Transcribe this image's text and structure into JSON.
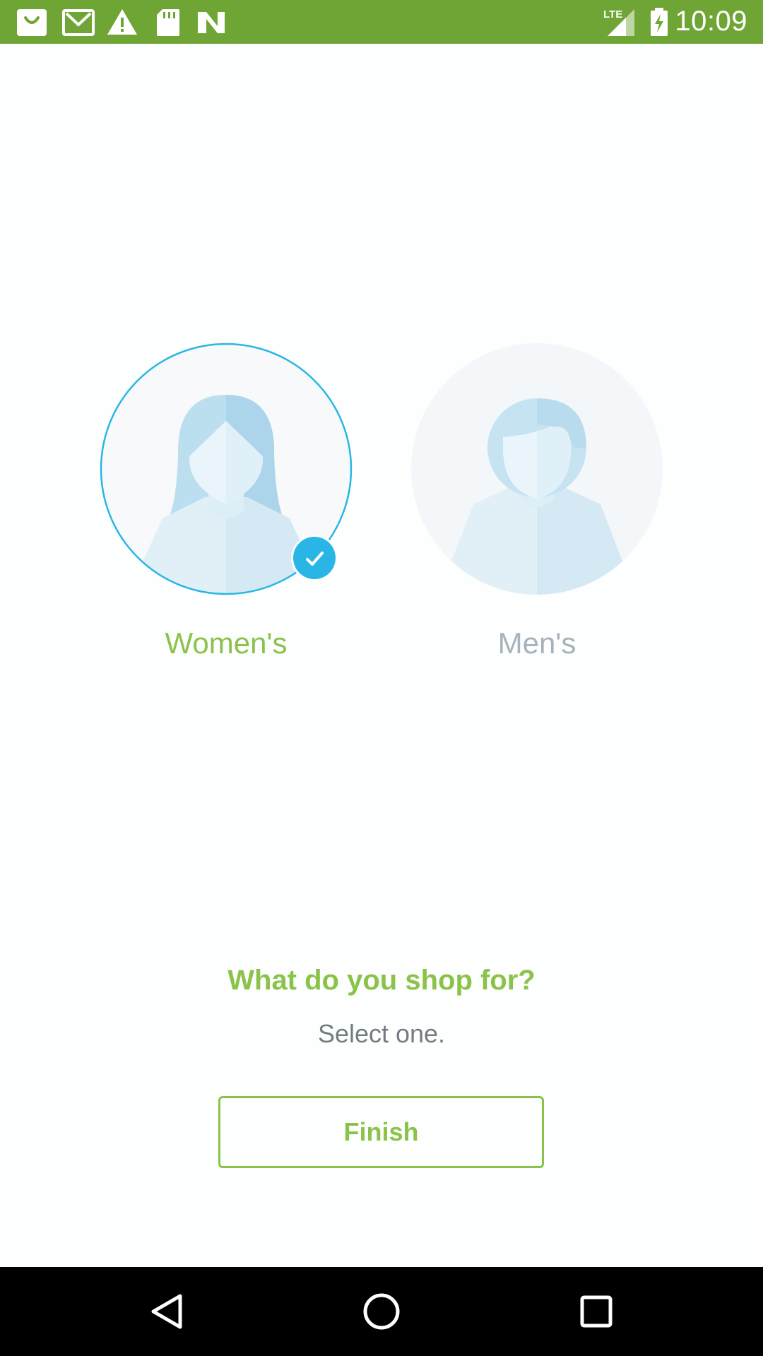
{
  "status_bar": {
    "time": "10:09",
    "network": "LTE",
    "icons": [
      "shopping-bag-icon",
      "gmail-icon",
      "warning-icon",
      "sd-card-icon",
      "n-icon",
      "lte-signal-icon",
      "battery-charging-icon"
    ],
    "background_color": "#6fa535"
  },
  "choices": [
    {
      "label": "Women's",
      "selected": true,
      "label_color": "#8bc34a"
    },
    {
      "label": "Men's",
      "selected": false,
      "label_color": "#a7b3bb"
    }
  ],
  "prompt": {
    "question": "What do you shop for?",
    "subtitle": "Select one."
  },
  "finish_button": {
    "label": "Finish"
  },
  "nav_bar": {
    "icons": [
      "back-icon",
      "home-icon",
      "recents-icon"
    ]
  },
  "colors": {
    "accent_green": "#8bc34a",
    "selection_blue": "#29b6e6",
    "avatar_light": "#d4e9f4",
    "avatar_dark": "#b4daee"
  }
}
